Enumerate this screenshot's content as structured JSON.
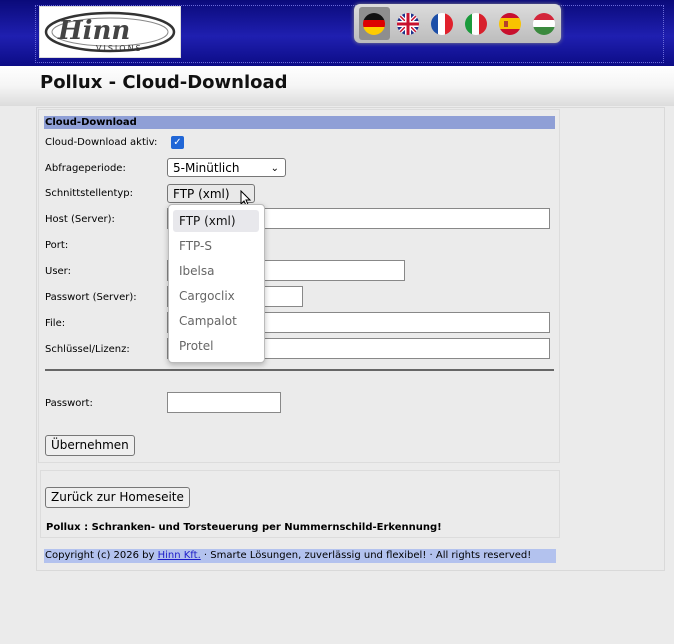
{
  "header": {
    "logo_text": "Hinn",
    "logo_subtext": "VISIONS",
    "languages": [
      {
        "name": "german-flag",
        "selected": true
      },
      {
        "name": "uk-flag"
      },
      {
        "name": "france-flag"
      },
      {
        "name": "italy-flag"
      },
      {
        "name": "spain-flag"
      },
      {
        "name": "hungary-flag"
      }
    ]
  },
  "page_title": "Pollux - Cloud-Download",
  "form": {
    "section_title": "Cloud-Download",
    "active_label": "Cloud-Download aktiv:",
    "active_checked": true,
    "period_label": "Abfrageperiode:",
    "period_value": "5-Minütlich",
    "interface_label": "Schnittstellentyp:",
    "interface_value": "FTP (xml)",
    "host_label": "Host (Server):",
    "host_value": "",
    "port_label": "Port:",
    "port_value": "",
    "user_label": "User:",
    "user_value": "",
    "server_password_label": "Passwort (Server):",
    "server_password_value": "",
    "file_label": "File:",
    "file_value": "",
    "key_label": "Schlüssel/Lizenz:",
    "key_value": "",
    "password_label": "Passwort:",
    "password_value": "",
    "apply_button": "Übernehmen"
  },
  "dropdown": {
    "options": [
      "FTP (xml)",
      "FTP-S",
      "Ibelsa",
      "Cargoclix",
      "Campalot",
      "Protel"
    ],
    "selected_index": 0
  },
  "back_button": "Zurück zur Homeseite",
  "tagline": "Pollux : Schranken- und Torsteuerung per Nummernschild-Erkennung!",
  "footer": {
    "prefix": "Copyright (c) 2026 by ",
    "link": "Hinn Kft.",
    "suffix": " · Smarte Lösungen, zuverlässig und flexibel! · All rights reserved!"
  },
  "colors": {
    "header": "#1414a0",
    "section_title_bg": "#8f9fd6",
    "footer_bg": "#b3c2ee",
    "checkbox": "#2066d6"
  }
}
